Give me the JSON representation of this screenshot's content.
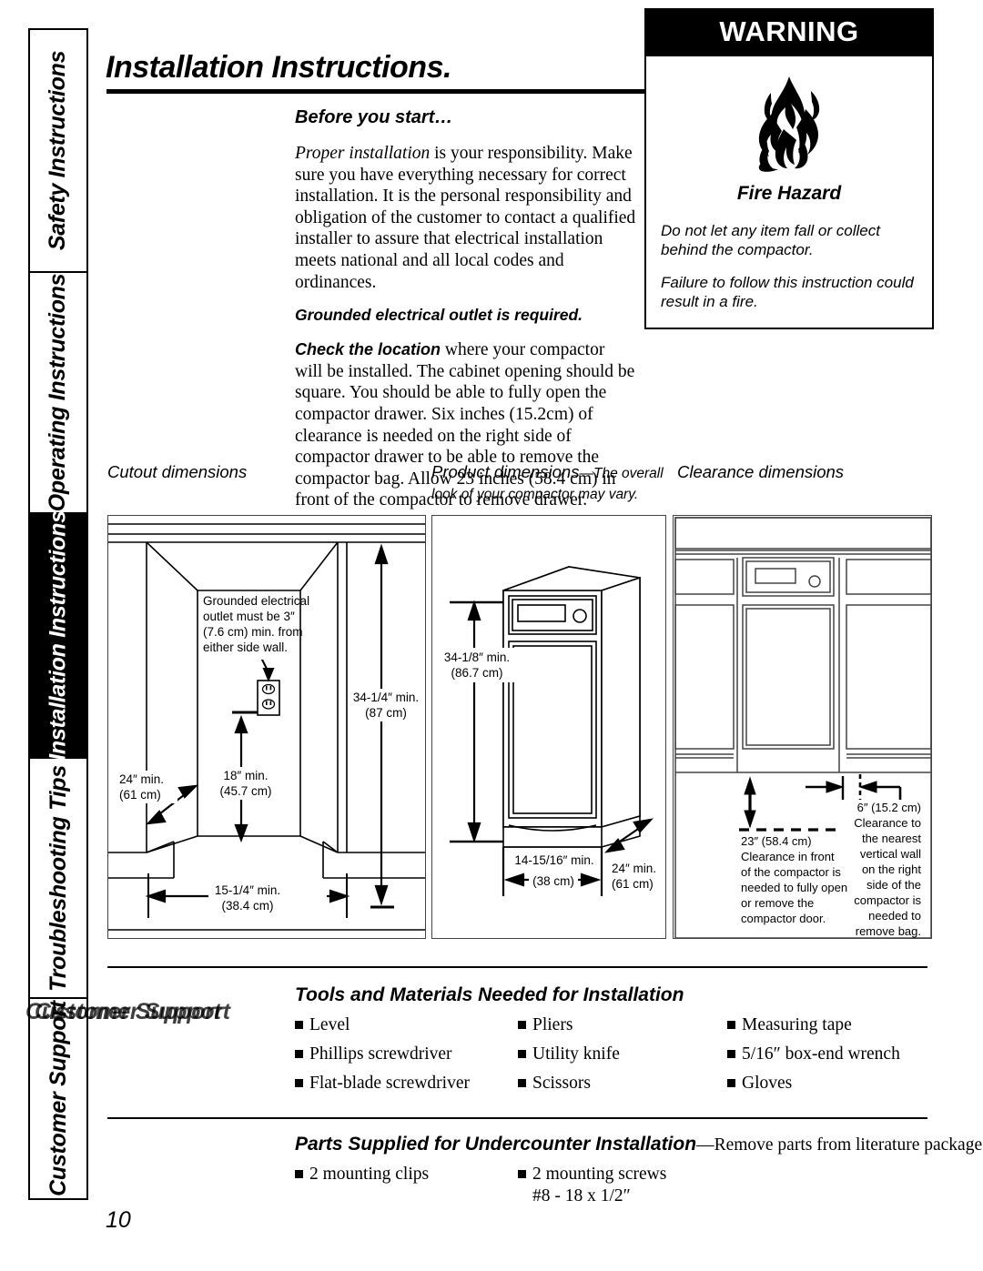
{
  "sidebar": {
    "tabs": [
      {
        "label": "Safety Instructions",
        "active": false
      },
      {
        "label": "Operating Instructions",
        "active": false
      },
      {
        "label": "Installation Instructions",
        "active": true
      },
      {
        "label": "Troubleshooting Tips",
        "active": false
      },
      {
        "label": "Customer Support",
        "active": false
      }
    ]
  },
  "header": {
    "title": "Installation Instructions."
  },
  "before_you_start": {
    "heading": "Before you start…",
    "para1_lead": "Proper installation",
    "para1_rest": " is your responsibility. Make sure you have everything necessary for correct installation. It is the personal responsibility and obligation of the customer to contact a qualified installer to assure that electrical installation meets national and all local codes and ordinances.",
    "note": "Grounded electrical outlet is required.",
    "para2_lead": "Check the location",
    "para2_rest": " where your compactor will be installed. The cabinet opening should be square. You should be able to fully open the compactor drawer. Six inches (15.2cm) of clearance is needed on the right side of compactor drawer to be able to remove the compactor bag. Allow 23 inches (58.4 cm) in front of the compactor to remove drawer."
  },
  "warning": {
    "header": "WARNING",
    "icon": "flame-icon",
    "hazard_title": "Fire Hazard",
    "line1": "Do not let any item fall or collect behind the compactor.",
    "line2": "Failure to follow this instruction could result in a fire."
  },
  "diagrams": {
    "cutout": {
      "caption": "Cutout dimensions",
      "outlet_note": [
        "Grounded electrical",
        "outlet must be 3″",
        "(7.6 cm) min. from",
        "either side wall."
      ],
      "dim_height": [
        "34-1/4″ min.",
        "(87 cm)"
      ],
      "dim_depth": [
        "24″ min.",
        "(61 cm)"
      ],
      "dim_outlet_height": [
        "18″ min.",
        "(45.7 cm)"
      ],
      "dim_width": [
        "15-1/4″ min.",
        "(38.4 cm)"
      ]
    },
    "product": {
      "caption_bold": "Product dimensions",
      "caption_rest": "—The overall look of your compactor may vary.",
      "dim_height": [
        "34-1/8″ min.",
        "(86.7 cm)"
      ],
      "dim_width": [
        "14-15/16″ min.",
        "(38 cm)"
      ],
      "dim_depth": [
        "24″ min.",
        "(61 cm)"
      ]
    },
    "clearance": {
      "caption": "Clearance dimensions",
      "front_note": [
        "23″ (58.4 cm)",
        "Clearance in front",
        "of the compactor is",
        "needed to fully open",
        "or remove the",
        "compactor door."
      ],
      "side_note": [
        "6″ (15.2 cm)",
        "Clearance to",
        "the nearest",
        "vertical wall",
        "on the right",
        "side of the",
        "compactor is",
        "needed to",
        "remove bag."
      ]
    }
  },
  "tools": {
    "title": "Tools and Materials Needed for Installation",
    "items": [
      "Level",
      "Pliers",
      "Measuring tape",
      "Phillips screwdriver",
      "Utility knife",
      "5/16″ box-end wrench",
      "Flat-blade screwdriver",
      "Scissors",
      "Gloves"
    ]
  },
  "parts": {
    "title_bold": "Parts Supplied for Undercounter Installation",
    "title_tail": "—Remove parts from literature package.",
    "items": [
      {
        "label": "2 mounting clips",
        "sub": ""
      },
      {
        "label": "2 mounting screws",
        "sub": "#8 - 18 x 1/2″"
      }
    ]
  },
  "footer": {
    "page_number": "10"
  },
  "colors": {
    "ink": "#000000",
    "paper": "#ffffff",
    "line": "#444444"
  }
}
